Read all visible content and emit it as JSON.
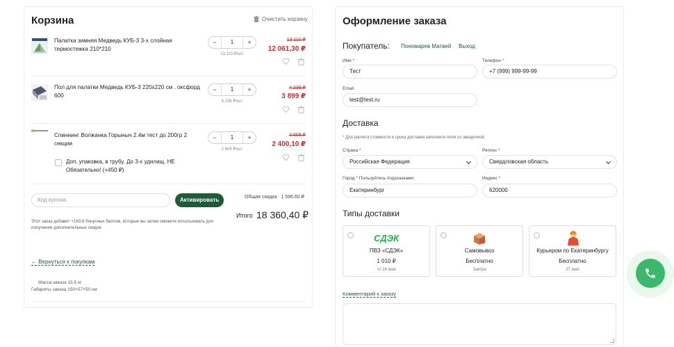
{
  "cart": {
    "title": "Корзина",
    "clear_label": "Очистить корзину",
    "items": [
      {
        "name": "Палатка зимняя Медведь КУБ-3 3-х слойная термостежка 210*210",
        "qty": "1",
        "unit_price": "13 110 ₽/шт.",
        "old_price": "13 110 ₽",
        "price": "12 061,30 ₽"
      },
      {
        "name": "Пол для палатки Медведь КУБ-3 220х220 см . оксфорд 600",
        "qty": "1",
        "unit_price": "4 238 ₽/шт.",
        "old_price": "4 238 ₽",
        "price": "3 899 ₽"
      },
      {
        "name": "Спиннинг Волжанка Горыныч 2.4м тест до 200гр 2 секции",
        "qty": "1",
        "unit_price": "2 609 ₽/шт.",
        "old_price": "2 609 ₽",
        "price": "2 400,10 ₽",
        "addon": "Доп. упаковка, в трубу. До 3-х удилищ. НЕ Обязательно! (+450 ₽)"
      }
    ],
    "stepper": {
      "minus": "−",
      "plus": "+"
    },
    "coupon_placeholder": "Код купона",
    "activate_label": "Активировать",
    "discount_label": "Общая скидка",
    "discount_value": "1 596.60 ₽",
    "total_label": "Итого",
    "total_value": "18 360,40 ₽",
    "bonus_text": "Этот заказ добавит +183.6 бонусных баллов, которые вы затем сможете использовать для получения дополнительных скидок.",
    "back_label": "← Вернуться к покупкам",
    "weight": "Масса заказа 15.5 кг",
    "dimensions": "Габариты заказа 150×57×50 см"
  },
  "checkout": {
    "title": "Оформление заказа",
    "buyer_label": "Покупатель:",
    "buyer_name": "Пономарев Матвей",
    "logout": "Выход",
    "name_label": "Имя",
    "name_value": "Тест",
    "phone_label": "Телефон",
    "phone_value": "+7 (999) 999-99-99",
    "email_label": "Email",
    "email_value": "test@test.ru",
    "delivery_title": "Доставка",
    "delivery_note": "* Для расчета стоимости и срока доставки заполните поля со звездочкой",
    "country_label": "Страна",
    "country_value": "Российская Федерация",
    "region_label": "Регион",
    "region_value": "Свердловская область",
    "city_label": "Город",
    "city_hint": "Пользуйтесь подсказками",
    "city_value": "Екатеринбург",
    "zip_label": "Индекс",
    "zip_value": "620000",
    "required_mark": "*",
    "types_title": "Типы доставки",
    "delivery_options": [
      {
        "logo": "СДЭК",
        "name": "ПВЗ «СДЭК»",
        "price": "1 010 ₽",
        "date": "от 26 мая"
      },
      {
        "name": "Самовывоз",
        "price": "Бесплатно",
        "date": "Завтра"
      },
      {
        "name": "Курьером по Екатеринбургу",
        "price": "Бесплатно",
        "date": "27 мая"
      }
    ],
    "comment_link": "Комментарий к заказу"
  },
  "colors": {
    "accent": "#1e5b3b",
    "price_red": "#c92b2b",
    "phone_green": "#3cb86b"
  }
}
